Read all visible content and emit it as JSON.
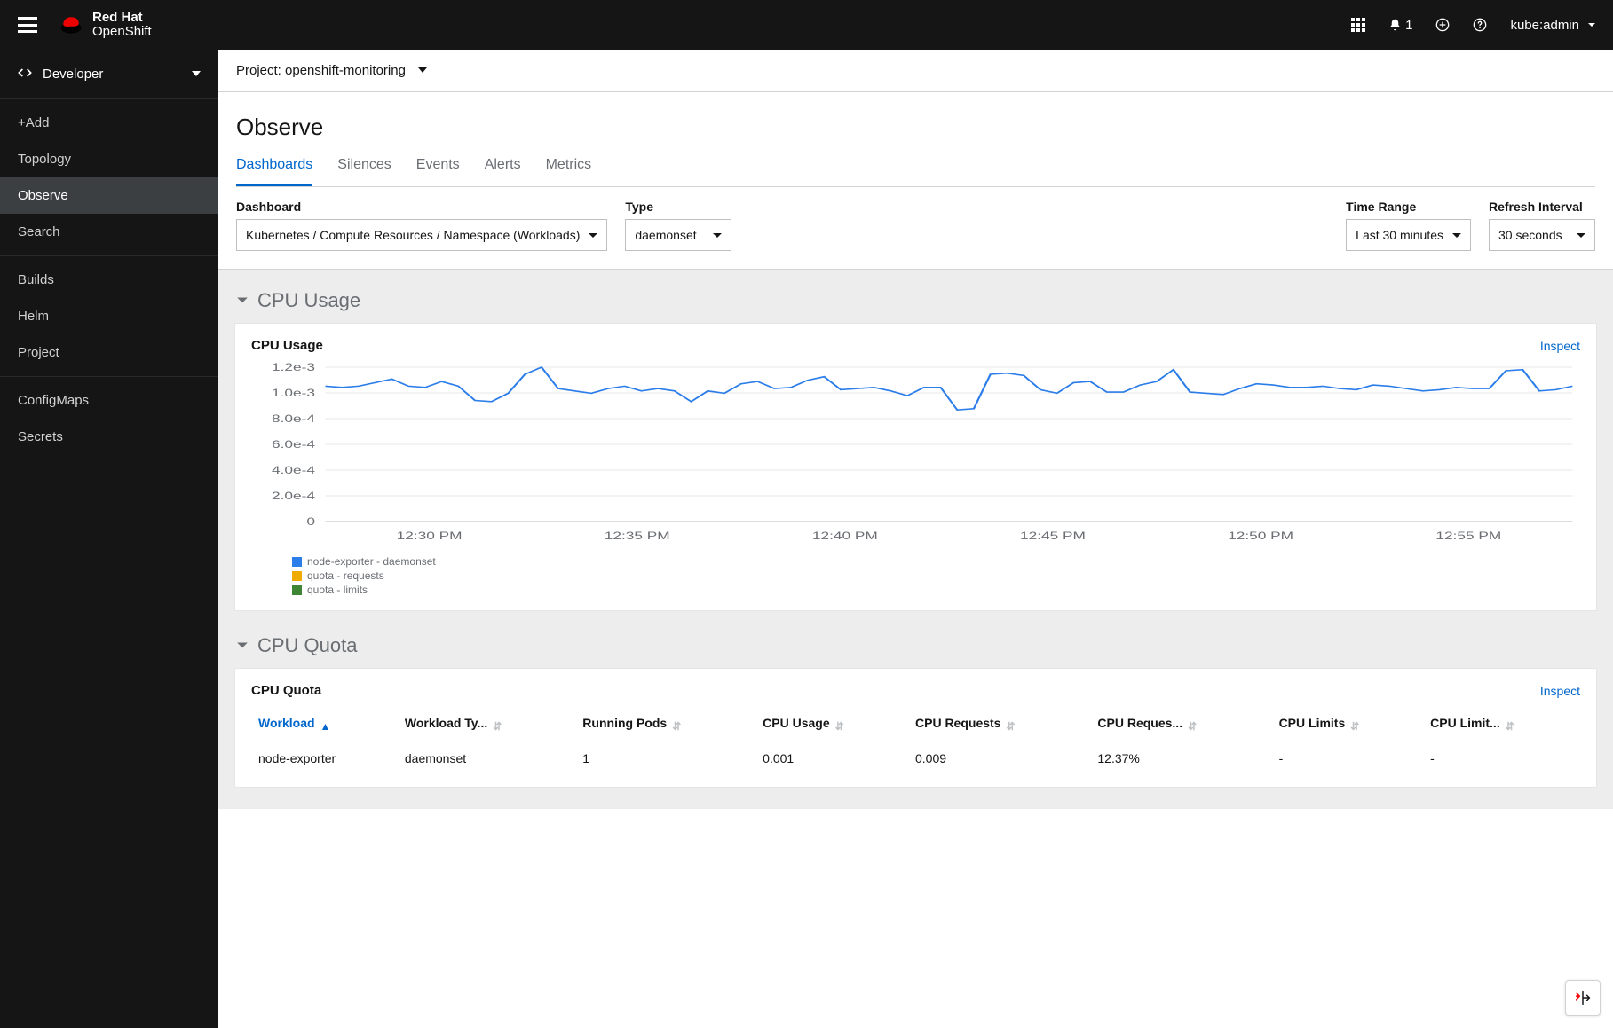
{
  "brand": {
    "line1": "Red Hat",
    "line2": "OpenShift"
  },
  "masthead": {
    "notification_count": "1",
    "user": "kube:admin"
  },
  "sidebar": {
    "perspective": "Developer",
    "groups": [
      {
        "items": [
          "+Add",
          "Topology",
          "Observe",
          "Search"
        ],
        "activeIndex": 2
      },
      {
        "items": [
          "Builds",
          "Helm",
          "Project"
        ]
      },
      {
        "items": [
          "ConfigMaps",
          "Secrets"
        ]
      }
    ]
  },
  "project_bar": {
    "label": "Project:",
    "value": "openshift-monitoring"
  },
  "page": {
    "title": "Observe",
    "tabs": [
      "Dashboards",
      "Silences",
      "Events",
      "Alerts",
      "Metrics"
    ],
    "active_tab": 0
  },
  "controls": {
    "dashboard_label": "Dashboard",
    "dashboard_value": "Kubernetes / Compute Resources / Namespace (Workloads)",
    "type_label": "Type",
    "type_value": "daemonset",
    "timerange_label": "Time Range",
    "timerange_value": "Last 30 minutes",
    "refresh_label": "Refresh Interval",
    "refresh_value": "30 seconds"
  },
  "sections": {
    "cpu_usage_title": "CPU Usage",
    "cpu_quota_title": "CPU Quota"
  },
  "cpu_usage_card": {
    "title": "CPU Usage",
    "inspect": "Inspect",
    "legend": [
      {
        "color": "#2b7de9",
        "label": "node-exporter - daemonset"
      },
      {
        "color": "#f0ab00",
        "label": "quota - requests"
      },
      {
        "color": "#3e8635",
        "label": "quota - limits"
      }
    ]
  },
  "cpu_quota_card": {
    "title": "CPU Quota",
    "inspect": "Inspect",
    "columns": [
      "Workload",
      "Workload Ty...",
      "Running Pods",
      "CPU Usage",
      "CPU Requests",
      "CPU Reques...",
      "CPU Limits",
      "CPU Limit..."
    ],
    "sorted_col": 0,
    "rows": [
      {
        "cells": [
          "node-exporter",
          "daemonset",
          "1",
          "0.001",
          "0.009",
          "12.37%",
          "-",
          "-"
        ]
      }
    ]
  },
  "chart_data": {
    "type": "line",
    "title": "CPU Usage",
    "xlabel": "",
    "ylabel": "",
    "x_ticks": [
      "12:30 PM",
      "12:35 PM",
      "12:40 PM",
      "12:45 PM",
      "12:50 PM",
      "12:55 PM"
    ],
    "y_ticks": [
      "0",
      "2.0e-4",
      "4.0e-4",
      "6.0e-4",
      "8.0e-4",
      "1.0e-3",
      "1.2e-3"
    ],
    "ylim": [
      0,
      0.0013
    ],
    "series": [
      {
        "name": "node-exporter - daemonset",
        "color": "#2b7de9",
        "values": [
          0.00114,
          0.00113,
          0.00114,
          0.00117,
          0.0012,
          0.00114,
          0.00113,
          0.00118,
          0.00114,
          0.00102,
          0.00101,
          0.00108,
          0.00124,
          0.0013,
          0.00112,
          0.0011,
          0.00108,
          0.00112,
          0.00114,
          0.0011,
          0.00112,
          0.0011,
          0.00101,
          0.0011,
          0.00108,
          0.00116,
          0.00118,
          0.00112,
          0.00113,
          0.00119,
          0.00122,
          0.00111,
          0.00112,
          0.00113,
          0.0011,
          0.00106,
          0.00113,
          0.00113,
          0.00094,
          0.00095,
          0.00124,
          0.00125,
          0.00123,
          0.00111,
          0.00108,
          0.00117,
          0.00118,
          0.00109,
          0.00109,
          0.00115,
          0.00118,
          0.00128,
          0.00109,
          0.00108,
          0.00107,
          0.00112,
          0.00116,
          0.00115,
          0.00113,
          0.00113,
          0.00114,
          0.00112,
          0.00111,
          0.00115,
          0.00114,
          0.00112,
          0.0011,
          0.00111,
          0.00113,
          0.00112,
          0.00112,
          0.00127,
          0.00128,
          0.0011,
          0.00111,
          0.00114
        ]
      },
      {
        "name": "quota - requests",
        "color": "#f0ab00",
        "values": []
      },
      {
        "name": "quota - limits",
        "color": "#3e8635",
        "values": []
      }
    ]
  }
}
